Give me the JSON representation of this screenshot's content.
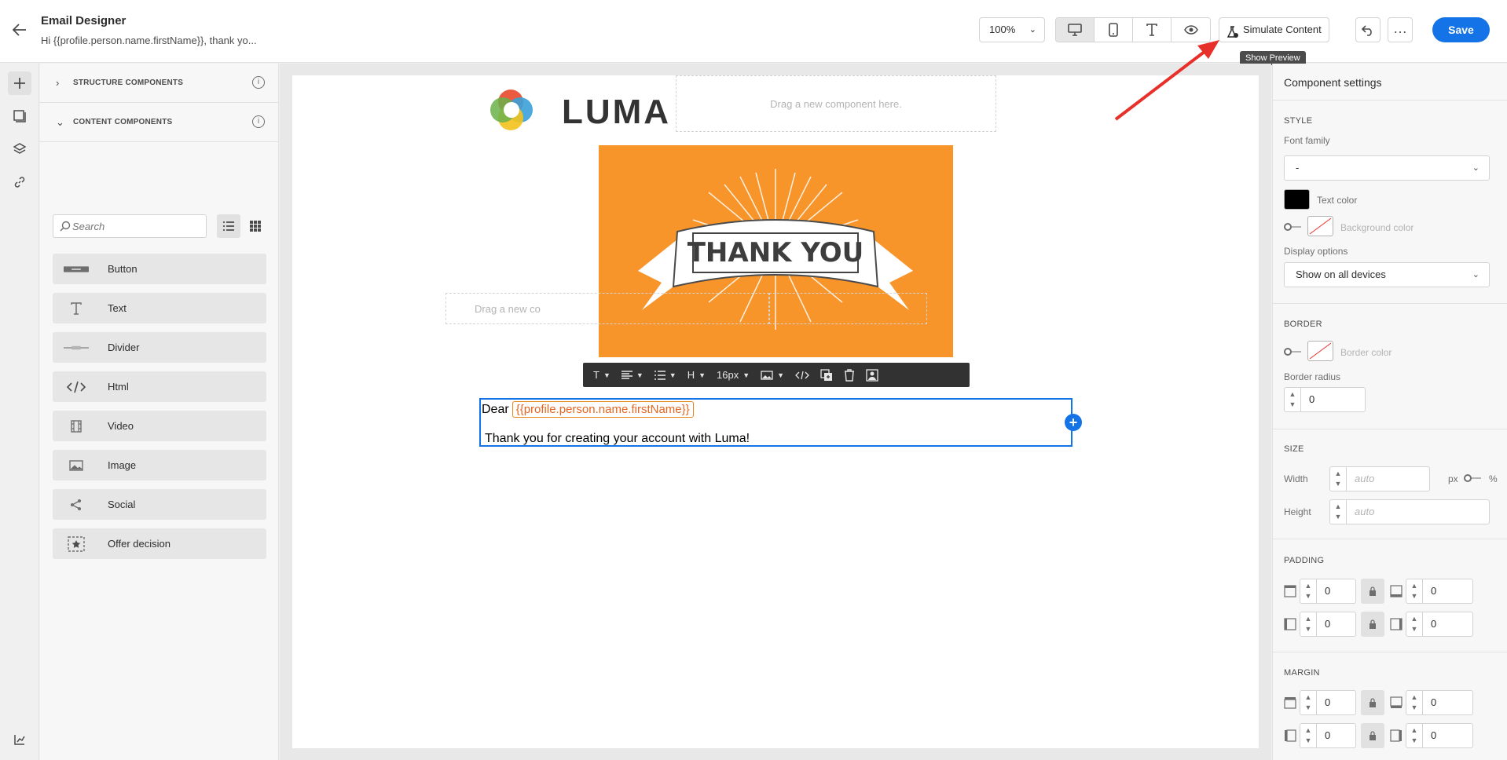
{
  "header": {
    "title": "Email Designer",
    "subtitle": "Hi {{profile.person.name.firstName}}, thank yo...",
    "zoom": "100%",
    "simulate_label": "Simulate Content",
    "tooltip": "Show Preview",
    "save_label": "Save"
  },
  "left_panel": {
    "structure_label": "STRUCTURE COMPONENTS",
    "content_label": "CONTENT COMPONENTS",
    "search_placeholder": "Search",
    "components": [
      {
        "label": "Button",
        "icon": "button-icon"
      },
      {
        "label": "Text",
        "icon": "text-icon"
      },
      {
        "label": "Divider",
        "icon": "divider-icon"
      },
      {
        "label": "Html",
        "icon": "code-icon"
      },
      {
        "label": "Video",
        "icon": "video-icon"
      },
      {
        "label": "Image",
        "icon": "image-icon"
      },
      {
        "label": "Social",
        "icon": "share-icon"
      },
      {
        "label": "Offer decision",
        "icon": "offer-icon"
      }
    ]
  },
  "canvas": {
    "logo_text": "LUMA",
    "dropzone_text": "Drag a new component here.",
    "dropzone2_text": "Drag a new co",
    "hero_text": "THANK YOU",
    "toolbar_font_size": "16px",
    "toolbar_heading": "H",
    "text_dear": "Dear",
    "token": "{{profile.person.name.firstName}}",
    "text_thanks": "Thank you for creating your account with Luma!"
  },
  "right_panel": {
    "title": "Component settings",
    "style_label": "STYLE",
    "font_family_label": "Font family",
    "font_family_value": "-",
    "text_color_label": "Text color",
    "text_color": "#000000",
    "bg_color_label": "Background color",
    "display_options_label": "Display options",
    "display_options_value": "Show on all devices",
    "border_label": "BORDER",
    "border_color_label": "Border color",
    "border_radius_label": "Border radius",
    "border_radius_value": "0",
    "size_label": "SIZE",
    "width_label": "Width",
    "width_placeholder": "auto",
    "height_label": "Height",
    "height_placeholder": "auto",
    "unit_px": "px",
    "unit_pct": "%",
    "padding_label": "PADDING",
    "padding_values": [
      "0",
      "0",
      "0",
      "0"
    ],
    "margin_label": "MARGIN",
    "margin_values": [
      "0",
      "0",
      "0",
      "0"
    ]
  },
  "colors": {
    "accent": "#1473e6",
    "hero_bg": "#f7952a",
    "token": "#e6651e",
    "annotation_arrow": "#e8302a"
  }
}
